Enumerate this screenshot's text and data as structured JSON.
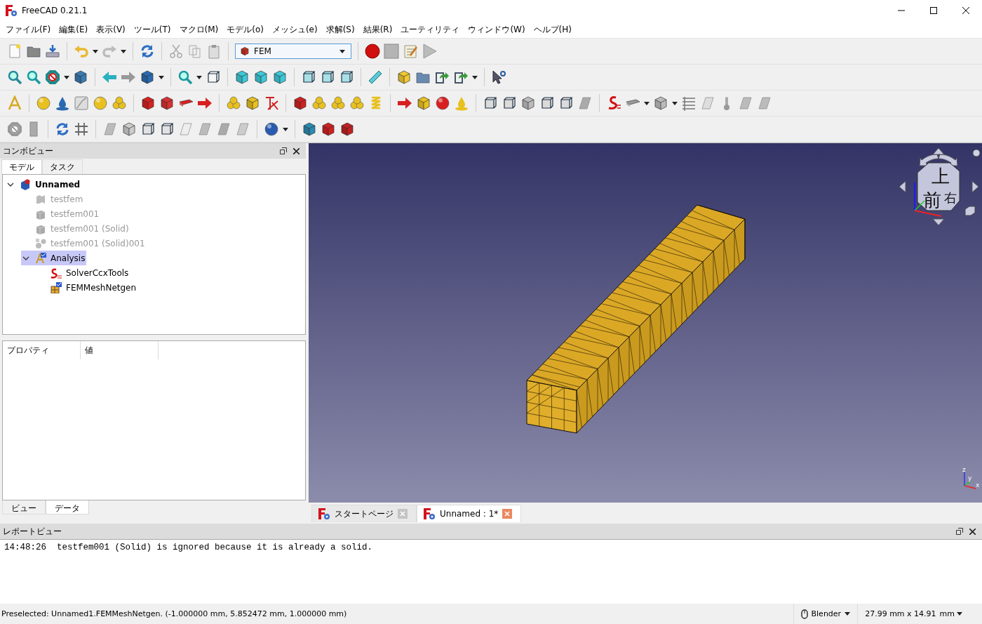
{
  "window": {
    "title": "FreeCAD 0.21.1"
  },
  "menu": [
    "ファイル(F)",
    "編集(E)",
    "表示(V)",
    "ツール(T)",
    "マクロ(M)",
    "モデル(o)",
    "メッシュ(e)",
    "求解(S)",
    "結果(R)",
    "ユーティリティ",
    "ウィンドウ(W)",
    "ヘルプ(H)"
  ],
  "toolbar": {
    "workbench": "FEM"
  },
  "combo_view": {
    "title": "コンボビュー",
    "tabs": [
      {
        "label": "モデル",
        "selected": true
      },
      {
        "label": "タスク",
        "selected": false
      }
    ],
    "tree": [
      {
        "label": "Unnamed",
        "kind": "document",
        "hidden": false,
        "selected": false,
        "expanded": true,
        "children": [
          {
            "label": "testfem",
            "kind": "shape",
            "hidden": true,
            "selected": false
          },
          {
            "label": "testfem001",
            "kind": "solid",
            "hidden": true,
            "selected": false
          },
          {
            "label": "testfem001 (Solid)",
            "kind": "solid",
            "hidden": true,
            "selected": false
          },
          {
            "label": "testfem001 (Solid)001",
            "kind": "compound",
            "hidden": true,
            "selected": false
          },
          {
            "label": "Analysis",
            "kind": "analysis",
            "hidden": false,
            "selected": true,
            "expanded": true,
            "children": [
              {
                "label": "SolverCcxTools",
                "kind": "solver",
                "hidden": false,
                "selected": false
              },
              {
                "label": "FEMMeshNetgen",
                "kind": "mesh",
                "hidden": false,
                "selected": false
              }
            ]
          }
        ]
      }
    ]
  },
  "property_view": {
    "columns": [
      "プロパティ",
      "値"
    ],
    "tabs": [
      {
        "label": "ビュー",
        "selected": false
      },
      {
        "label": "データ",
        "selected": true
      }
    ]
  },
  "viewport": {
    "nav_cube": {
      "faces": [
        "上",
        "前",
        "右"
      ]
    },
    "axis_labels": [
      "z",
      "y",
      "x"
    ]
  },
  "view_tabs": [
    {
      "label": "スタートページ",
      "selected": false
    },
    {
      "label": "Unnamed : 1*",
      "selected": true
    }
  ],
  "report_view": {
    "title": "レポートビュー",
    "lines": [
      "14:48:26  testfem001 (Solid) is ignored because it is already a solid."
    ]
  },
  "status_bar": {
    "message": "Preselected: Unnamed1.FEMMeshNetgen. (-1.000000 mm, 5.852472 mm, 1.000000 mm)",
    "navigation": "Blender",
    "dimensions": "27.99 mm x 14.91",
    "unit": "mm"
  }
}
